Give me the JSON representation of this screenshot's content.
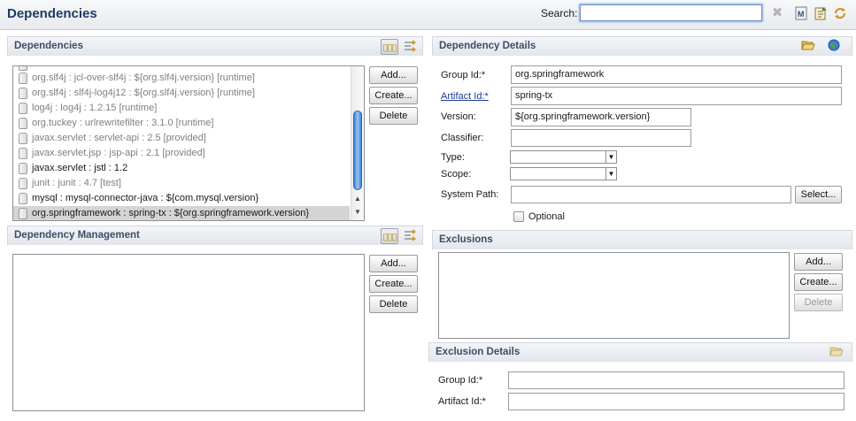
{
  "header": {
    "title": "Dependencies",
    "search_label": "Search:",
    "search_value": "",
    "icons": [
      "clear-icon",
      "pom-icon",
      "refresh-pom-icon",
      "sync-icon"
    ]
  },
  "dependencies": {
    "title": "Dependencies",
    "items": [
      {
        "text": "org.slf4j : jcl-over-slf4j : ${org.slf4j.version} [runtime]"
      },
      {
        "text": "org.slf4j : slf4j-log4j12 : ${org.slf4j.version} [runtime]"
      },
      {
        "text": "log4j : log4j : 1.2.15 [runtime]"
      },
      {
        "text": "org.tuckey : urlrewritefilter : 3.1.0 [runtime]"
      },
      {
        "text": "javax.servlet : servlet-api : 2.5 [provided]"
      },
      {
        "text": "javax.servlet.jsp : jsp-api : 2.1 [provided]"
      },
      {
        "text": "javax.servlet : jstl : 1.2"
      },
      {
        "text": "junit : junit : 4.7 [test]"
      },
      {
        "text": "mysql : mysql-connector-java : ${com.mysql.version}"
      },
      {
        "text": "org.springframework : spring-tx : ${org.springframework.version}"
      }
    ],
    "buttons": {
      "add": "Add...",
      "create": "Create...",
      "delete": "Delete"
    }
  },
  "dependency_management": {
    "title": "Dependency Management",
    "buttons": {
      "add": "Add...",
      "create": "Create...",
      "delete": "Delete"
    }
  },
  "dependency_details": {
    "title": "Dependency Details",
    "group_id_label": "Group Id:*",
    "group_id_value": "org.springframework",
    "artifact_id_label": "Artifact Id:*",
    "artifact_id_value": "spring-tx",
    "version_label": "Version:",
    "version_value": "${org.springframework.version}",
    "classifier_label": "Classifier:",
    "classifier_value": "",
    "type_label": "Type:",
    "type_value": "",
    "scope_label": "Scope:",
    "scope_value": "",
    "system_path_label": "System Path:",
    "system_path_value": "",
    "select_button": "Select...",
    "optional_label": "Optional"
  },
  "exclusions": {
    "title": "Exclusions",
    "buttons": {
      "add": "Add...",
      "create": "Create...",
      "delete": "Delete"
    }
  },
  "exclusion_details": {
    "title": "Exclusion Details",
    "group_id_label": "Group Id:*",
    "artifact_id_label": "Artifact Id:*"
  }
}
